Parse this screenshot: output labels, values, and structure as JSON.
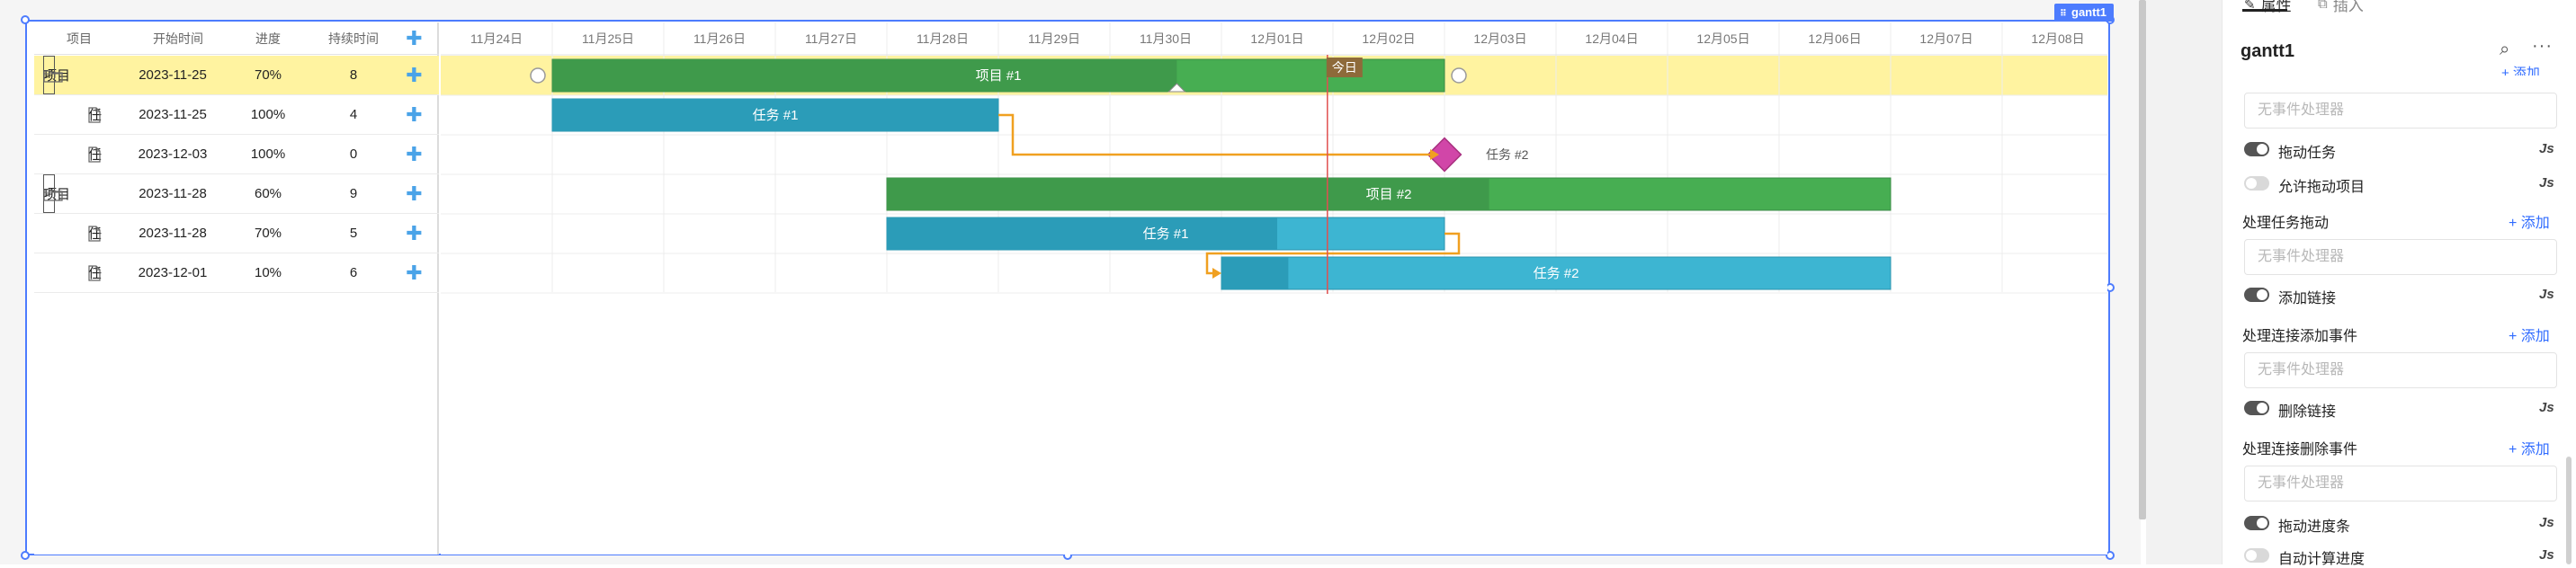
{
  "component": {
    "name": "gantt1"
  },
  "grid": {
    "headers": {
      "project": "项目",
      "start": "开始时间",
      "progress": "进度",
      "duration": "持续时间",
      "add": "✚"
    },
    "rows": [
      {
        "type": "project",
        "name": "项目",
        "start": "2023-11-25",
        "progress": "70%",
        "duration": "8",
        "selected": true
      },
      {
        "type": "task",
        "name": "任",
        "start": "2023-11-25",
        "progress": "100%",
        "duration": "4"
      },
      {
        "type": "milestone",
        "name": "任",
        "start": "2023-12-03",
        "progress": "100%",
        "duration": "0"
      },
      {
        "type": "project",
        "name": "项目",
        "start": "2023-11-28",
        "progress": "60%",
        "duration": "9"
      },
      {
        "type": "task",
        "name": "任",
        "start": "2023-11-28",
        "progress": "70%",
        "duration": "5"
      },
      {
        "type": "task",
        "name": "任",
        "start": "2023-12-01",
        "progress": "10%",
        "duration": "6"
      }
    ]
  },
  "timeline": {
    "dates": [
      "11月24日",
      "11月25日",
      "11月26日",
      "11月27日",
      "11月28日",
      "11月29日",
      "11月30日",
      "12月01日",
      "12月02日",
      "12月03日",
      "12月04日",
      "12月05日",
      "12月06日",
      "12月07日",
      "12月08日"
    ],
    "today_label": "今日",
    "bars": [
      {
        "label": "项目 #1",
        "kind": "project",
        "progress": 0.7
      },
      {
        "label": "任务 #1",
        "kind": "task",
        "progress": 1.0
      },
      {
        "label": "任务 #2",
        "kind": "milestone"
      },
      {
        "label": "项目 #2",
        "kind": "project",
        "progress": 0.6
      },
      {
        "label": "任务 #1",
        "kind": "task",
        "progress": 0.7
      },
      {
        "label": "任务 #2",
        "kind": "task",
        "progress": 0.1
      }
    ],
    "colors": {
      "project": "#3f9a4b",
      "project_rest": "#47ae52",
      "task": "#2b9cb8",
      "task_rest": "#3db5d2",
      "milestone": "#d146a8",
      "link": "#f0a020",
      "today": "#e05050",
      "selected_row": "#fff3a0"
    }
  },
  "panel": {
    "tabs": {
      "properties": "属性",
      "insert": "插入"
    },
    "title": "gantt1",
    "no_handler": "无事件处理器",
    "add_label": "+ 添加",
    "js_label": "Js",
    "toggles": {
      "drag_task": "拖动任务",
      "allow_drag_project": "允许拖动项目",
      "add_link": "添加链接",
      "delete_link": "删除链接",
      "drag_progress": "拖动进度条",
      "auto_calc_progress": "自动计算进度"
    },
    "sections": {
      "handle_task_drag": "处理任务拖动",
      "handle_link_add": "处理连接添加事件",
      "handle_link_delete": "处理连接删除事件"
    }
  }
}
